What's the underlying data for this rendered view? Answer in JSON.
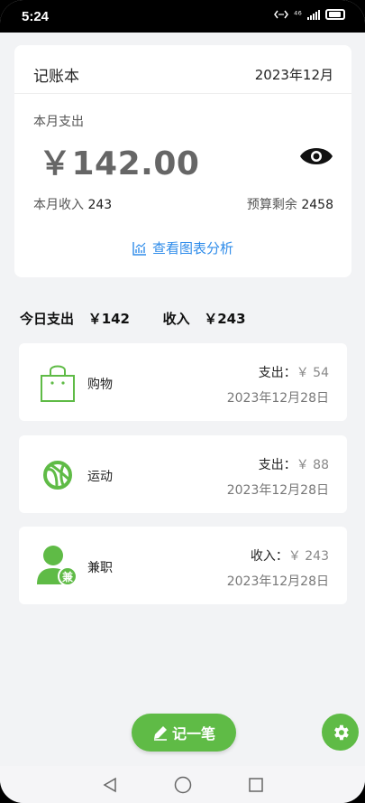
{
  "status": {
    "time": "5:24",
    "network": "⁴⁶"
  },
  "header": {
    "title": "记账本",
    "month": "2023年12月"
  },
  "summary": {
    "expense_label": "本月支出",
    "expense_amount": "￥142.00",
    "income_label": "本月收入",
    "income_value": "243",
    "budget_label": "预算剩余",
    "budget_value": "2458",
    "chart_link": "查看图表分析"
  },
  "today": {
    "expense_label": "今日支出",
    "expense_value": "￥142",
    "income_label": "收入",
    "income_value": "￥243"
  },
  "records": [
    {
      "icon": "shopping-bag-icon",
      "category": "购物",
      "type_label": "支出：",
      "amount": "￥ 54",
      "date": "2023年12月28日"
    },
    {
      "icon": "basketball-icon",
      "category": "运动",
      "type_label": "支出：",
      "amount": "￥ 88",
      "date": "2023年12月28日"
    },
    {
      "icon": "part-time-user-icon",
      "category": "兼职",
      "type_label": "收入：",
      "amount": "￥ 243",
      "date": "2023年12月28日",
      "badge": "兼"
    }
  ],
  "actions": {
    "record_label": "记一笔"
  },
  "colors": {
    "accent": "#5fbb46",
    "link": "#2f8cea"
  }
}
